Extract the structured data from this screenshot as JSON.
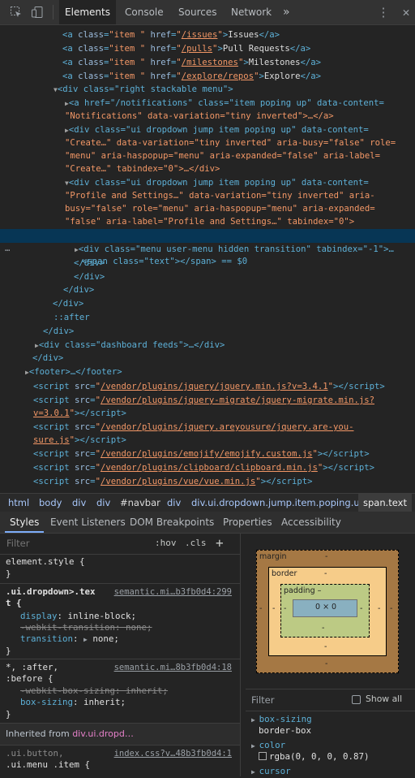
{
  "toolbar": {
    "tabs": [
      "Elements",
      "Console",
      "Sources",
      "Network"
    ],
    "more": "»"
  },
  "dom": {
    "lines": [
      {
        "k": "a",
        "href": "/issues",
        "text": "Issues"
      },
      {
        "k": "a",
        "href": "/pulls",
        "text": "Pull Requests"
      },
      {
        "k": "a",
        "href": "/milestones",
        "text": "Milestones"
      },
      {
        "k": "a",
        "href": "/explore/repos",
        "text": "Explore"
      }
    ],
    "right_menu": "<div class=\"right stackable menu\">",
    "notif_1": "<a href=\"/notifications\" class=\"item poping up\" data-content=",
    "notif_2": "\"Notifications\" data-variation=\"tiny inverted\">…</a>",
    "create_1": "<div class=\"ui dropdown jump item poping up\" data-content=",
    "create_2": "\"Create…\" data-variation=\"tiny inverted\" aria-busy=\"false\" role=",
    "create_3": "\"menu\" aria-haspopup=\"menu\" aria-expanded=\"false\" aria-label=",
    "create_4": "\"Create…\" tabindex=\"0\">…</div>",
    "profile_1": "<div class=\"ui dropdown jump item poping up\" data-content=",
    "profile_2": "\"Profile and Settings…\" data-variation=\"tiny inverted\" aria-",
    "profile_3": "busy=\"false\" role=\"menu\" aria-haspopup=\"menu\" aria-expanded=",
    "profile_4": "\"false\" aria-label=\"Profile and Settings…\" tabindex=\"0\">",
    "selected": "<span class=\"text\"></span> == $0",
    "usermenu": "<div class=\"menu user-menu hidden transition\" tabindex=\"-1\">…",
    "close_div": "</div>",
    "after": "::after",
    "dashboard": "<div class=\"dashboard feeds\">…</div>",
    "footer": "<footer>…</footer>",
    "scripts": [
      "/vendor/plugins/jquery/jquery.min.js?v=3.4.1",
      "/vendor/plugins/jquery-migrate/jquery-migrate.min.js?",
      "v=3.0.1",
      "/vendor/plugins/jquery.areyousure/jquery.are-you-",
      "sure.js",
      "/vendor/plugins/emojify/emojify.custom.js",
      "/vendor/plugins/clipboard/clipboard.min.js",
      "/vendor/plugins/vue/vue.min.js"
    ],
    "ellipsis": "…"
  },
  "breadcrumb": [
    "html",
    "body",
    "div",
    "div",
    "#navbar",
    "div",
    "div.ui.dropdown.jump.item.poping.up",
    "span.text"
  ],
  "style_tabs": [
    "Styles",
    "Event Listeners",
    "DOM Breakpoints",
    "Properties",
    "Accessibility"
  ],
  "filter": {
    "placeholder": "Filter",
    "hov": ":hov",
    "cls": ".cls",
    "add": "+"
  },
  "rules": {
    "element_style": "element.style {",
    "close": "}",
    "r1_sel_a": ".ui.dropdown>.tex",
    "r1_sel_b": "t {",
    "r1_src": "semantic.mi…b3fb0d4:299",
    "r1_p1": "display",
    "r1_v1": "inline-block;",
    "r1_p2": "-webkit-transition",
    "r1_v2": "none;",
    "r1_p3": "transition",
    "r1_v3": "none;",
    "r2_sel_a": "*, :after,",
    "r2_sel_b": ":before {",
    "r2_src": "semantic.mi…8b3fb0d4:18",
    "r2_p1": "-webkit-box-sizing",
    "r2_v1": "inherit;",
    "r2_p2": "box-sizing",
    "r2_v2": "inherit;",
    "inherited_label": "Inherited from ",
    "inherited_target": "div.ui.dropd…",
    "r3_sel_a": ".ui.button,",
    "r3_sel_b": ".ui.menu .item {",
    "r3_src": "index.css?v…48b3fb0d4:1"
  },
  "box": {
    "margin": "margin",
    "border": "border",
    "padding": "padding",
    "content": "0 × 0",
    "dash": "-",
    "dash2": "–"
  },
  "computed": {
    "filter": "Filter",
    "show_all": "Show all",
    "p1": "box-sizing",
    "v1": "border-box",
    "p2": "color",
    "v2": "rgba(0, 0, 0, 0.87)",
    "p3": "cursor"
  }
}
